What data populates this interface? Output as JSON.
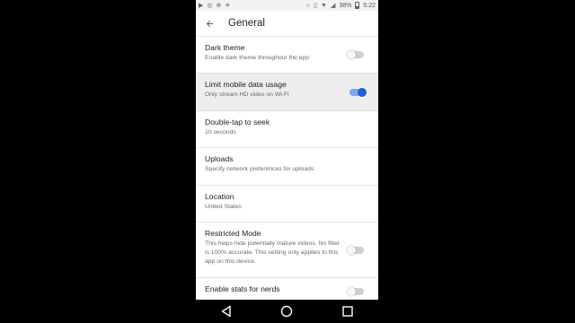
{
  "status_bar": {
    "battery_text": "38%",
    "time": "5:22"
  },
  "header": {
    "title": "General"
  },
  "settings": [
    {
      "title": "Dark theme",
      "subtitle": "Enable dark theme throughout the app",
      "toggle": false
    },
    {
      "title": "Limit mobile data usage",
      "subtitle": "Only stream HD video on Wi-Fi",
      "toggle": true
    },
    {
      "title": "Double-tap to seek",
      "subtitle": "10 seconds"
    },
    {
      "title": "Uploads",
      "subtitle": "Specify network preferences for uploads"
    },
    {
      "title": "Location",
      "subtitle": "United States"
    },
    {
      "title": "Restricted Mode",
      "subtitle": "This helps hide potentially mature videos. No filter is 100% accurate. This setting only applies to this app on this device.",
      "toggle": false
    },
    {
      "title": "Enable stats for nerds",
      "toggle": false
    }
  ],
  "colors": {
    "accent": "#1a62d8",
    "toggle_track_on": "#7fa6ea",
    "highlight_row": "#eeeeee"
  }
}
